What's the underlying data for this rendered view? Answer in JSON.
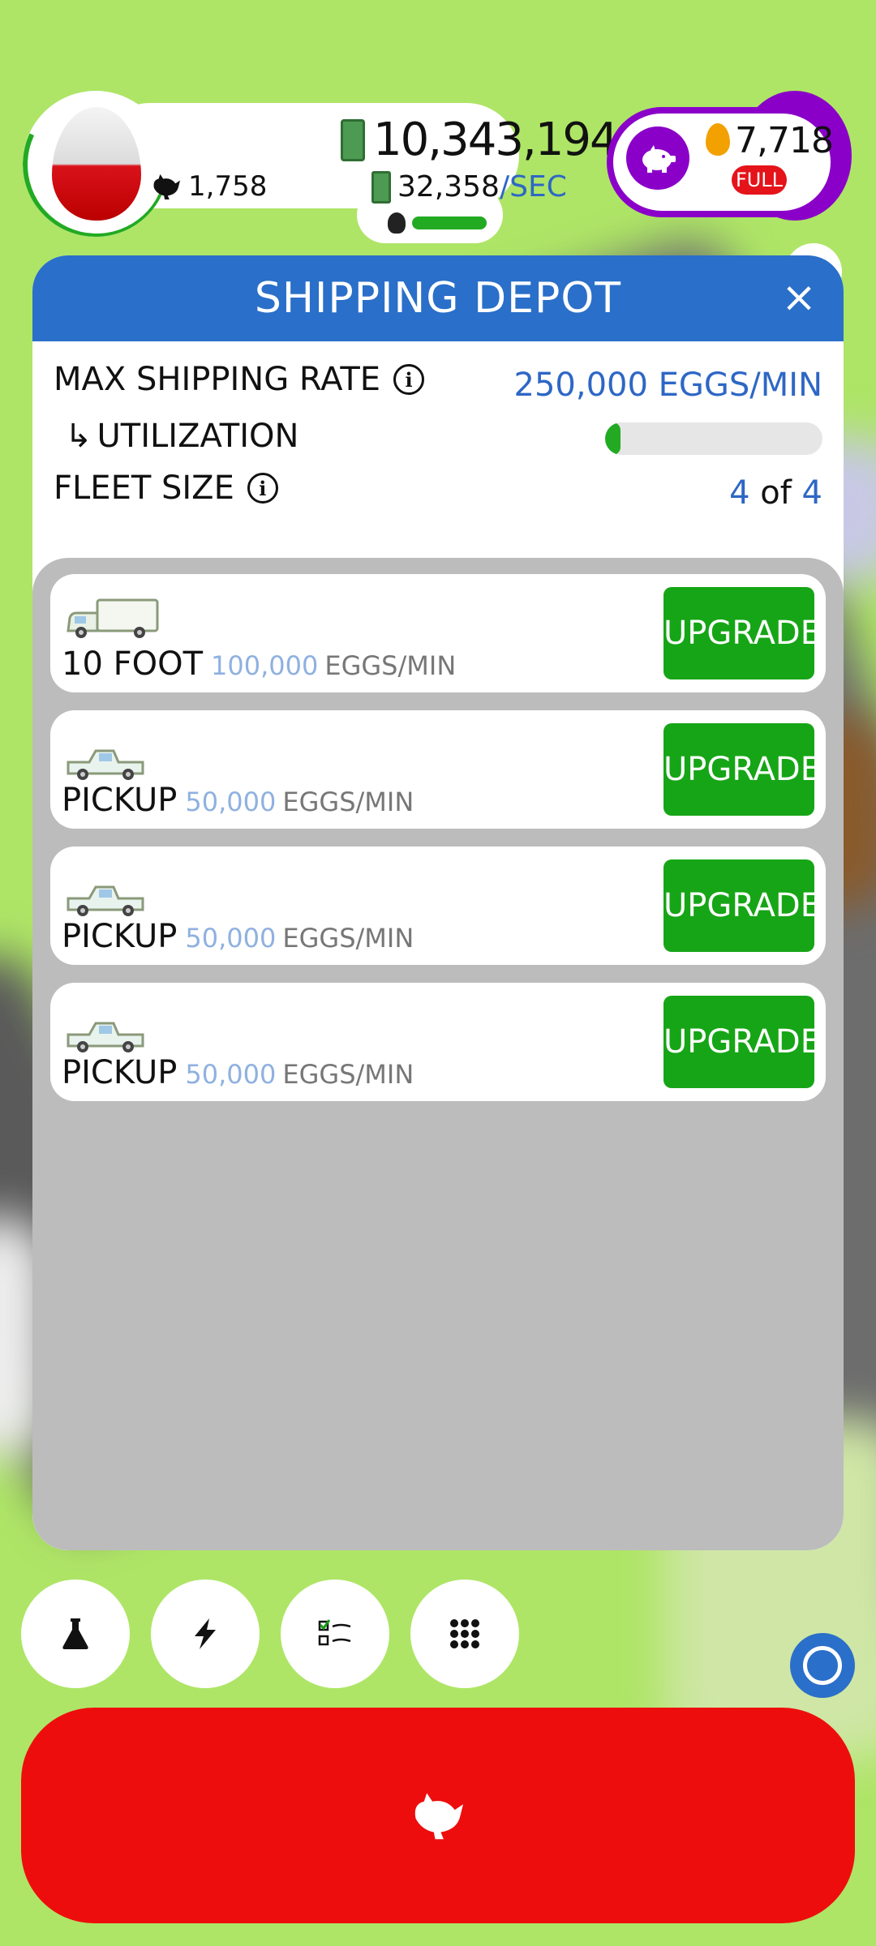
{
  "hud": {
    "chicken_count": "1,758",
    "money": "10,343,194",
    "money_rate": "32,358",
    "money_rate_unit": "/SEC",
    "golden_eggs": "7,718",
    "full_label": "FULL"
  },
  "modal": {
    "title": "SHIPPING DEPOT",
    "close_icon": "×",
    "max_shipping_rate_label": "MAX SHIPPING RATE",
    "max_shipping_rate_value": "250,000 EGGS/MIN",
    "utilization_label": "UTILIZATION",
    "utilization_arrow": "↳",
    "utilization_fraction": 0.07,
    "fleet_size_label": "FLEET SIZE",
    "fleet_current": "4",
    "fleet_of": "of",
    "fleet_max": "4"
  },
  "fleet": [
    {
      "name": "10 FOOT",
      "capacity": "100,000",
      "unit": "EGGS/MIN",
      "button": "UPGRADE",
      "icon": "box-truck-icon"
    },
    {
      "name": "PICKUP",
      "capacity": "50,000",
      "unit": "EGGS/MIN",
      "button": "UPGRADE",
      "icon": "pickup-truck-icon"
    },
    {
      "name": "PICKUP",
      "capacity": "50,000",
      "unit": "EGGS/MIN",
      "button": "UPGRADE",
      "icon": "pickup-truck-icon"
    },
    {
      "name": "PICKUP",
      "capacity": "50,000",
      "unit": "EGGS/MIN",
      "button": "UPGRADE",
      "icon": "pickup-truck-icon"
    }
  ],
  "bottom_nav": [
    {
      "icon": "flask-icon"
    },
    {
      "icon": "lightning-icon"
    },
    {
      "icon": "checklist-icon"
    },
    {
      "icon": "grid-menu-icon"
    }
  ],
  "colors": {
    "header_blue": "#2a6fc9",
    "upgrade_green": "#16a516",
    "hatch_red": "#ee0d0d",
    "background_green": "#aee566",
    "accent_purple": "#8a00c9"
  }
}
